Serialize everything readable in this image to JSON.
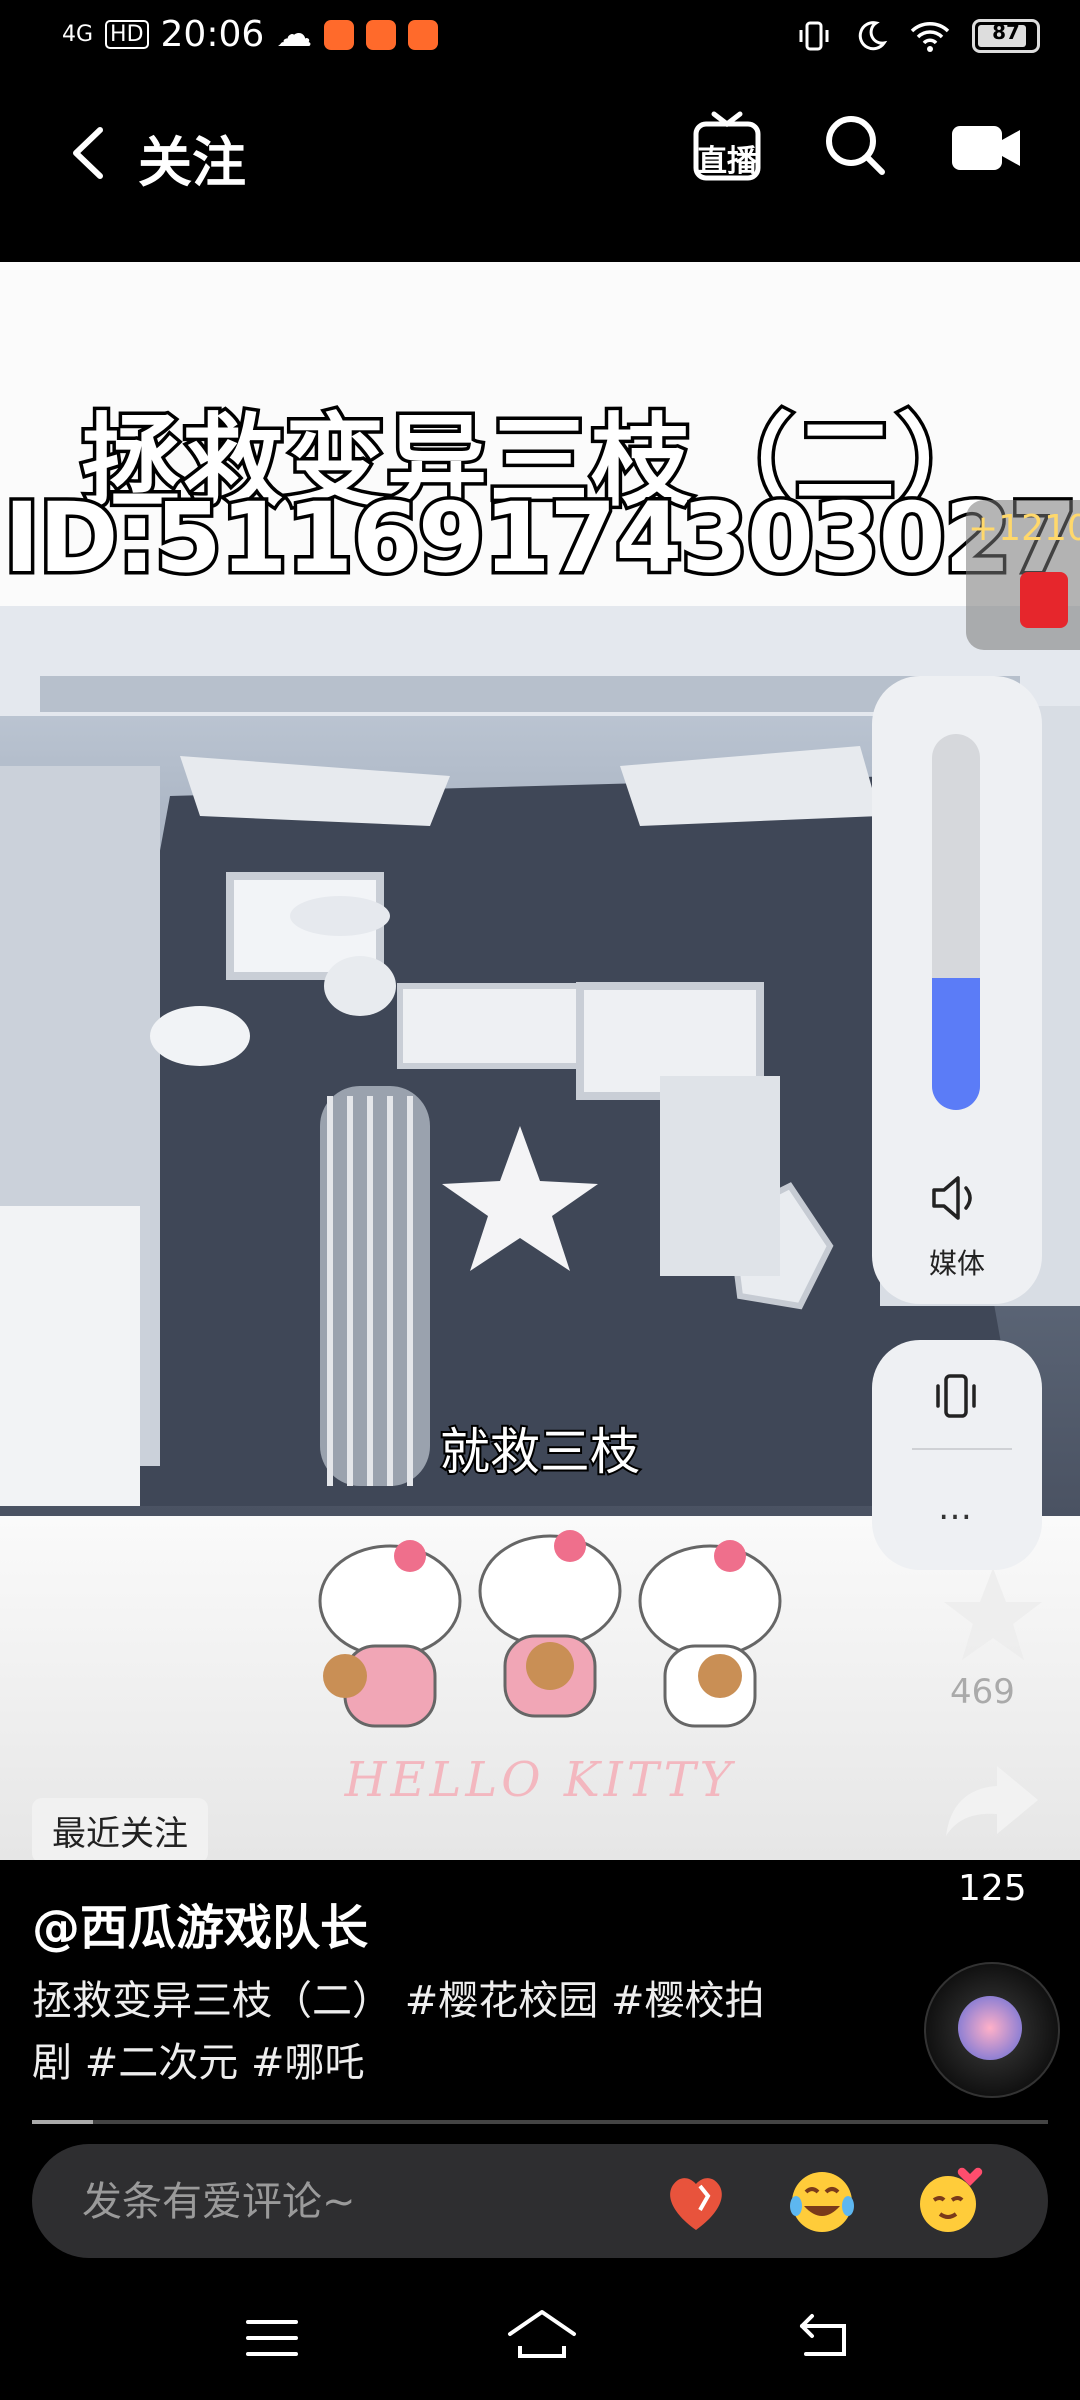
{
  "status_bar": {
    "network": "4G",
    "hd": "HD",
    "time": "20:06",
    "battery": "87",
    "battery_level": 0.87
  },
  "nav": {
    "title": "关注",
    "live_label": "直播"
  },
  "video": {
    "cover_title": "拯救变异三枝（二）",
    "cover_id": "ID:51169174303027",
    "subtitle": "就救三枝",
    "kitty_text": "HELLO KITTY",
    "recent_chip": "最近关注"
  },
  "rail": {
    "reward_count": "+1210",
    "like_count": "469",
    "share_count": "125"
  },
  "volume_overlay": {
    "level": 0.35,
    "media_label": "媒体",
    "more_label": "…"
  },
  "post": {
    "author": "@西瓜游戏队长",
    "description": "拯救变异三枝（二） #樱花校园 #樱校拍剧 #二次元 #哪吒",
    "progress": 0.06
  },
  "comment": {
    "placeholder": "发条有爱评论~",
    "emojis": [
      "heart-fire-emoji",
      "laughing-tears-emoji",
      "smiling-hearts-emoji"
    ]
  },
  "colors": {
    "accent": "#5b7cf7",
    "background": "#000000",
    "reward": "#e6262c"
  }
}
